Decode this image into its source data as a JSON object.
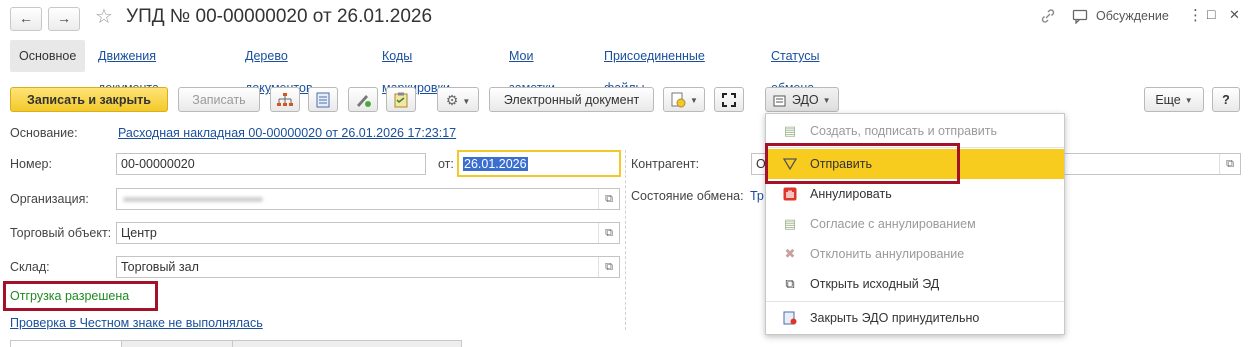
{
  "header": {
    "back_glyph": "←",
    "forward_glyph": "→",
    "star_glyph": "☆",
    "title": "УПД № 00-00000020 от 26.01.2026",
    "discussion_label": "Обсуждение",
    "more_glyph": "⋮",
    "restore_glyph": "□",
    "close_glyph": "✕"
  },
  "tabs": [
    {
      "label": "Основное"
    },
    {
      "label": "Движения документа"
    },
    {
      "label": "Дерево документов"
    },
    {
      "label": "Коды маркировки"
    },
    {
      "label": "Мои заметки"
    },
    {
      "label": "Присоединенные файлы"
    },
    {
      "label": "Статусы обмена"
    }
  ],
  "toolbar": {
    "save_close": "Записать и закрыть",
    "save": "Записать",
    "electronic_doc": "Электронный документ",
    "edo": "ЭДО",
    "more": "Еще",
    "help": "?"
  },
  "form": {
    "basis_label": "Основание:",
    "basis_link": "Расходная накладная 00-00000020 от 26.01.2026 17:23:17",
    "number_label": "Номер:",
    "number_value": "00-00000020",
    "date_label": "от:",
    "date_value": "26.01.2026",
    "org_label": "Организация:",
    "trade_label": "Торговый объект:",
    "trade_value": "Центр",
    "warehouse_label": "Склад:",
    "warehouse_value": "Торговый зал",
    "shipping_status": "Отгрузка разрешена",
    "check_link": "Проверка в Честном знаке не выполнялась",
    "counterparty_label": "Контрагент:",
    "counterparty_value": "О",
    "exchange_label": "Состояние обмена:",
    "exchange_value": "Тр"
  },
  "edo_menu": {
    "items": [
      {
        "label": "Создать, подписать и отправить",
        "icon": "doc-plus-icon",
        "glyph": "▤",
        "disabled": true
      },
      {
        "label": "Отправить",
        "icon": "send-icon",
        "glyph": "▽",
        "selected": true
      },
      {
        "label": "Аннулировать",
        "icon": "hand-stop-icon",
        "glyph": "✋"
      },
      {
        "label": "Согласие с аннулированием",
        "icon": "doc-check-icon",
        "glyph": "▤",
        "disabled": true
      },
      {
        "label": "Отклонить аннулирование",
        "icon": "cross-icon",
        "glyph": "✖",
        "disabled": true
      },
      {
        "label": "Открыть исходный ЭД",
        "icon": "open-window-icon",
        "glyph": "⧉"
      },
      {
        "label": "Закрыть ЭДО принудительно",
        "icon": "doc-close-icon",
        "glyph": "▤"
      }
    ]
  },
  "colors": {
    "accent_yellow": "#f8cc1f",
    "link_blue": "#1a4f9c",
    "highlight_red": "#a4122a",
    "status_green": "#1f8a1f"
  }
}
